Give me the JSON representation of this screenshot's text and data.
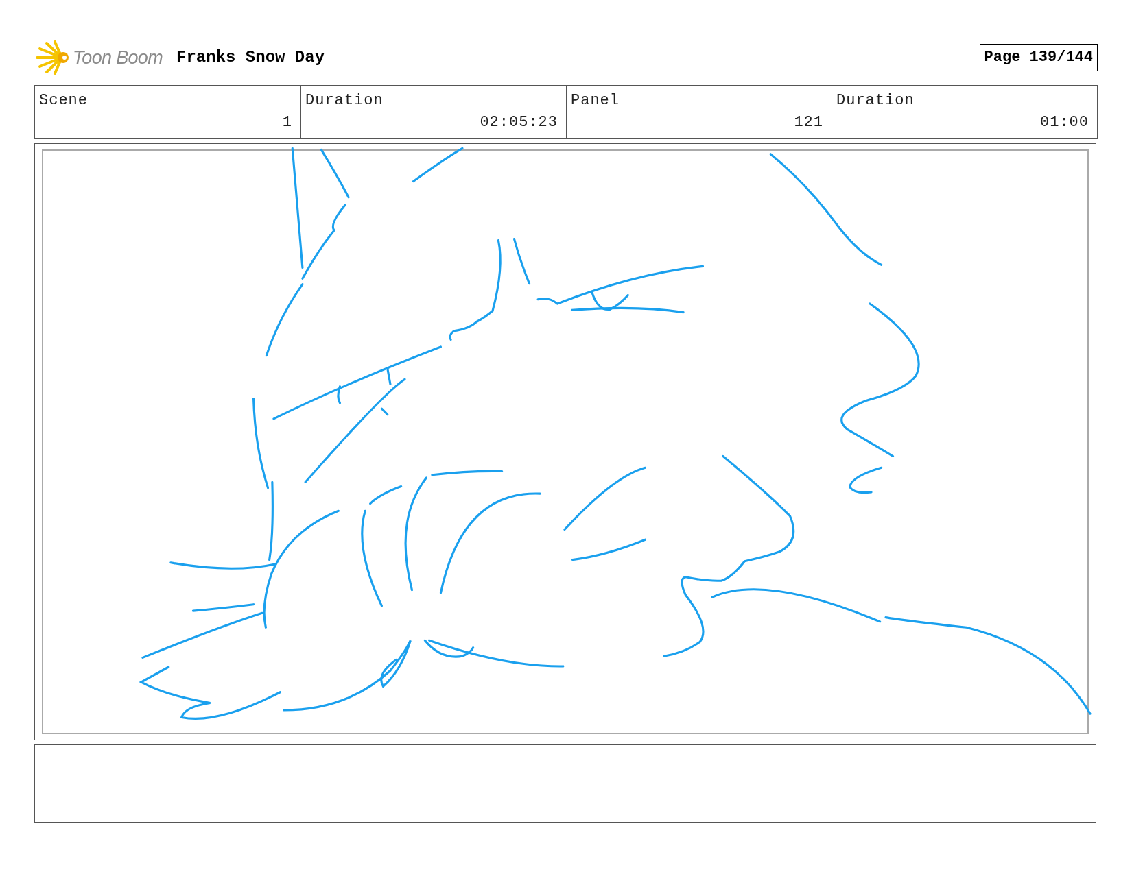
{
  "header": {
    "logo_text": "Toon Boom",
    "title": "Franks Snow Day",
    "page": "Page 139/144"
  },
  "info": [
    {
      "label": "Scene",
      "value": "1"
    },
    {
      "label": "Duration",
      "value": "02:05:23"
    },
    {
      "label": "Panel",
      "value": "121"
    },
    {
      "label": "Duration",
      "value": "01:00"
    }
  ]
}
